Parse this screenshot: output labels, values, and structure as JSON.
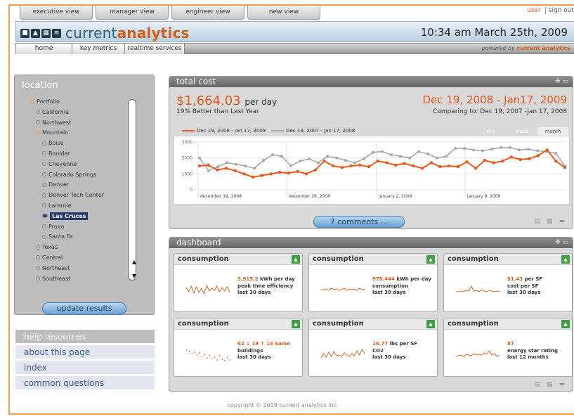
{
  "top_tabs": [
    "executive view",
    "manager view",
    "engineer view",
    "new view"
  ],
  "user_bar": {
    "user": "user",
    "sign_out": "sign out"
  },
  "header": {
    "brand_prefix": "current",
    "brand_suffix": "analytics",
    "datetime": "10:34 am  March 25th, 2009"
  },
  "nav_tabs": [
    "home",
    "key metrics",
    "realtime services"
  ],
  "powered_by": {
    "label": "powered by",
    "name": "current analytics"
  },
  "location": {
    "title": "location",
    "items": [
      {
        "label": "Portfolio",
        "depth": 0,
        "expanded": true
      },
      {
        "label": "California",
        "depth": 1
      },
      {
        "label": "Northwest",
        "depth": 1
      },
      {
        "label": "Mountain",
        "depth": 1,
        "expanded": true
      },
      {
        "label": "Boise",
        "depth": 2
      },
      {
        "label": "Boulder",
        "depth": 2
      },
      {
        "label": "Cheyenne",
        "depth": 2
      },
      {
        "label": "Colorado Springs",
        "depth": 2
      },
      {
        "label": "Denver",
        "depth": 2
      },
      {
        "label": "Denver Tech Center",
        "depth": 2
      },
      {
        "label": "Laramie",
        "depth": 2
      },
      {
        "label": "Las Cruces",
        "depth": 2,
        "selected": true
      },
      {
        "label": "Provo",
        "depth": 2
      },
      {
        "label": "Santa Fe",
        "depth": 2
      },
      {
        "label": "Texas",
        "depth": 1
      },
      {
        "label": "Central",
        "depth": 1
      },
      {
        "label": "Northeast",
        "depth": 1
      },
      {
        "label": "Southeast",
        "depth": 1
      }
    ],
    "update_button": "update results"
  },
  "help": {
    "title": "help resources",
    "links": [
      "about this page",
      "index",
      "common questions"
    ]
  },
  "total_cost": {
    "title": "total cost",
    "amount": "$1,664.03",
    "unit": "per day",
    "comparison": "19% Better than Last Year",
    "date_range": "Dec 19, 2008 - Jan17, 2009",
    "comparing_to": "Comparing to: Dec 19, 2007 -Jan 17, 2008",
    "legend_current": "Dec 19, 2008 - Jan 17, 2009",
    "legend_prior": "Dec 19, 2007 - Jan 17, 2008",
    "periods": [
      "day",
      "week",
      "month"
    ],
    "active_period": "month",
    "comments_button": "7 comments ...",
    "colors": {
      "current": "#e85a1e",
      "prior": "#a8a8a8"
    }
  },
  "chart_data": {
    "type": "line",
    "x_ticks": [
      "december 19, 2008",
      "december 26, 2008",
      "january 2, 2009",
      "january 9, 2009"
    ],
    "y_ticks": [
      0,
      1000,
      2000,
      3000
    ],
    "ylim": [
      0,
      3000
    ],
    "series": [
      {
        "name": "Dec 19, 2008 - Jan 17, 2009",
        "values": [
          1500,
          1550,
          1250,
          1350,
          1200,
          1000,
          800,
          900,
          1000,
          1100,
          1050,
          1150,
          1000,
          1250,
          1800,
          1500,
          1400,
          1500,
          1550,
          1450,
          1800,
          1700,
          1550,
          1650,
          1500,
          1350,
          1700,
          1450,
          1500,
          1450,
          1750,
          1350,
          1850,
          1700,
          1800,
          2050,
          1900,
          1950,
          2150,
          2500,
          1800,
          1400
        ]
      },
      {
        "name": "Dec 19, 2007 - Jan 17, 2008",
        "values": [
          2000,
          1200,
          1450,
          1700,
          1600,
          1500,
          1350,
          1850,
          2200,
          2100,
          1500,
          1800,
          1950,
          1700,
          2100,
          2000,
          1850,
          1700,
          1950,
          2350,
          2400,
          2200,
          2100,
          2000,
          2400,
          2250,
          2000,
          2100,
          2600,
          2600,
          2500,
          2450,
          2550,
          2650,
          2650,
          2500,
          2550,
          2450,
          2400,
          2300,
          1500
        ]
      }
    ]
  },
  "dashboard": {
    "title": "dashboard",
    "tiles": [
      {
        "title": "consumption",
        "line1_value": "3,915.2",
        "line1_rest": " kWh per day",
        "line2": "peak time efficiency",
        "line3": "last 30 days",
        "spark": [
          8,
          14,
          6,
          16,
          7,
          15,
          9,
          17,
          5,
          13,
          9,
          12,
          6,
          14,
          8,
          13,
          7,
          15
        ]
      },
      {
        "title": "consumption",
        "line1_value": "978.444",
        "line1_rest": " kWh per day",
        "line2": "consumption",
        "line3": "last 30 days",
        "spark": [
          12,
          11,
          10,
          12,
          9,
          11,
          10,
          12,
          11,
          9,
          12,
          10,
          11,
          10,
          12,
          9,
          11,
          10
        ]
      },
      {
        "title": "consumption",
        "line1_value": "$1.43",
        "line1_rest": " per SF",
        "line2": "cost per SF",
        "line3": "last 30 days",
        "spark": [
          14,
          14,
          13,
          14,
          12,
          13,
          6,
          13,
          12,
          14,
          11,
          13,
          14,
          12,
          13,
          14,
          13,
          14
        ]
      },
      {
        "title": "consumption",
        "line1_value": "62 ↓ 19 ↑ 14 Same",
        "line1_rest": "",
        "line2": "buildings",
        "line3": "last 30 days",
        "spark": [
          4,
          6,
          9,
          7,
          11,
          8,
          13,
          10,
          15,
          12,
          16,
          14,
          18,
          12,
          17,
          19,
          15,
          18
        ]
      },
      {
        "title": "consumption",
        "line1_value": "16.77",
        "line1_rest": " lbs per SF",
        "line2": "CO2",
        "line3": "last 30 days",
        "spark": [
          16,
          10,
          15,
          8,
          14,
          7,
          13,
          12,
          14,
          9,
          12,
          14,
          10,
          13,
          6,
          12,
          4,
          10
        ]
      },
      {
        "title": "consumption",
        "line1_value": "87",
        "line1_rest": "",
        "line2": "energy star rating",
        "line3": "last 12 months",
        "spark": [
          14,
          13,
          12,
          14,
          11,
          12,
          13,
          10,
          12,
          11,
          12,
          9,
          11,
          6,
          12,
          10,
          14,
          12
        ]
      }
    ]
  },
  "footer": "copyright © 2009 current analytics inc."
}
